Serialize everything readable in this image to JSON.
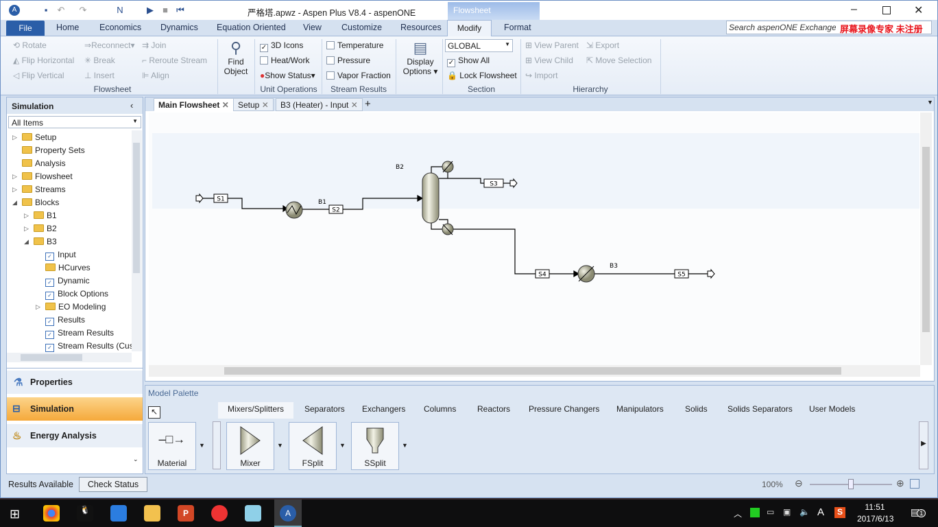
{
  "title": "严格塔.apwz - Aspen Plus V8.4 - aspenONE",
  "context_tab": "Flowsheet",
  "ribbon_tabs": [
    "File",
    "Home",
    "Economics",
    "Dynamics",
    "Equation Oriented",
    "View",
    "Customize",
    "Resources",
    "Modify",
    "Format"
  ],
  "search_placeholder": "Search aspenONE Exchange",
  "watermark": "屏幕录像专家 未注册",
  "ribbon": {
    "flowsheet": {
      "rotate": "Rotate",
      "flip_h": "Flip Horizontal",
      "flip_v": "Flip Vertical",
      "reconnect": "Reconnect",
      "break": "Break",
      "insert": "Insert",
      "join": "Join",
      "reroute": "Reroute Stream",
      "align": "Align",
      "group": "Flowsheet"
    },
    "find_object": [
      "Find",
      "Object"
    ],
    "unit_ops": {
      "icons3d": "3D Icons",
      "heatwork": "Heat/Work",
      "show_status": "Show Status",
      "group": "Unit Operations"
    },
    "stream_results": {
      "temperature": "Temperature",
      "pressure": "Pressure",
      "vapor_fraction": "Vapor Fraction",
      "group": "Stream Results"
    },
    "display_options": [
      "Display",
      "Options"
    ],
    "section": {
      "value": "GLOBAL",
      "show_all": "Show All",
      "lock": "Lock Flowsheet",
      "group": "Section"
    },
    "hierarchy": {
      "view_parent": "View Parent",
      "view_child": "View Child",
      "import": "Import",
      "export": "Export",
      "move_selection": "Move Selection",
      "group": "Hierarchy"
    }
  },
  "nav": {
    "title": "Simulation",
    "filter": "All Items",
    "tree": [
      "Setup",
      "Property Sets",
      "Analysis",
      "Flowsheet",
      "Streams",
      "Blocks",
      "B1",
      "B2",
      "B3",
      "Input",
      "HCurves",
      "Dynamic",
      "Block Options",
      "EO Modeling",
      "Results",
      "Stream Results",
      "Stream Results (Cus"
    ],
    "buttons": [
      "Properties",
      "Simulation",
      "Energy Analysis"
    ]
  },
  "doc_tabs": [
    "Main Flowsheet",
    "Setup",
    "B3 (Heater) - Input"
  ],
  "flowsheet": {
    "streams": [
      "S1",
      "S2",
      "S3",
      "S4",
      "S5"
    ],
    "blocks": [
      "B1",
      "B2",
      "B3"
    ]
  },
  "palette": {
    "title": "Model Palette",
    "tabs": [
      "Mixers/Splitters",
      "Separators",
      "Exchangers",
      "Columns",
      "Reactors",
      "Pressure Changers",
      "Manipulators",
      "Solids",
      "Solids Separators",
      "User Models"
    ],
    "items": [
      "Material",
      "Mixer",
      "FSplit",
      "SSplit"
    ]
  },
  "status": {
    "text": "Results Available",
    "check": "Check Status",
    "zoom": "100%",
    "zoom_fraction": 0.5
  },
  "taskbar": {
    "time": "11:51",
    "date": "2017/6/13",
    "notifications": "1"
  }
}
